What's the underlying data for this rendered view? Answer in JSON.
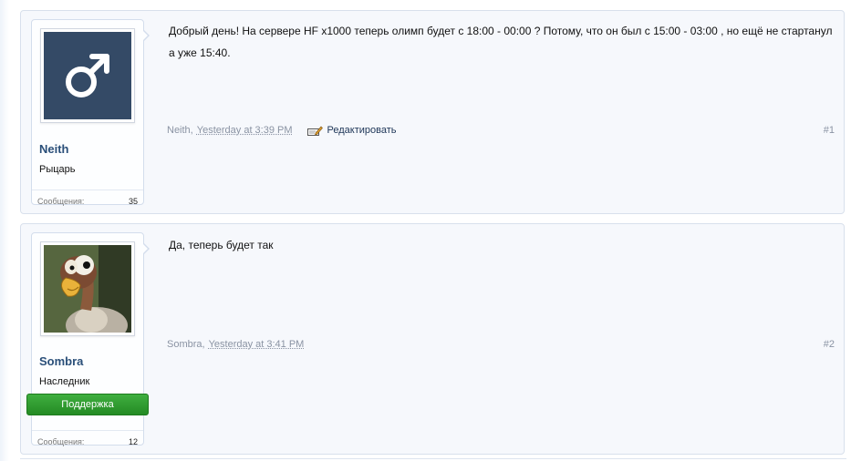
{
  "posts": [
    {
      "username": "Neith",
      "user_title": "Рыцарь",
      "avatar_icon": "male-symbol-icon",
      "stats_label": "Сообщения:",
      "stats_value": "35",
      "message": "Добрый день! На сервере HF x1000 теперь олимп будет с 18:00 - 00:00 ? Потому, что он был с 15:00 - 03:00 , но ещё не стартанул а уже 15:40.",
      "meta_author": "Neith,",
      "meta_date": "Yesterday at 3:39 PM",
      "edit_label": "Редактировать",
      "post_number": "#1"
    },
    {
      "username": "Sombra",
      "user_title": "Наследник",
      "avatar_icon": "vulture-avatar",
      "role_banner": "Поддержка",
      "stats_label": "Сообщения:",
      "stats_value": "12",
      "message": "Да, теперь будет так",
      "meta_author": "Sombra,",
      "meta_date": "Yesterday at 3:41 PM",
      "post_number": "#2"
    }
  ],
  "colors": {
    "post_background": "#f6f8fc",
    "username": "#2a4f79",
    "avatar_background": "#344a66",
    "role_banner": "#2e9a2e",
    "meta_text": "#8a93a3"
  }
}
